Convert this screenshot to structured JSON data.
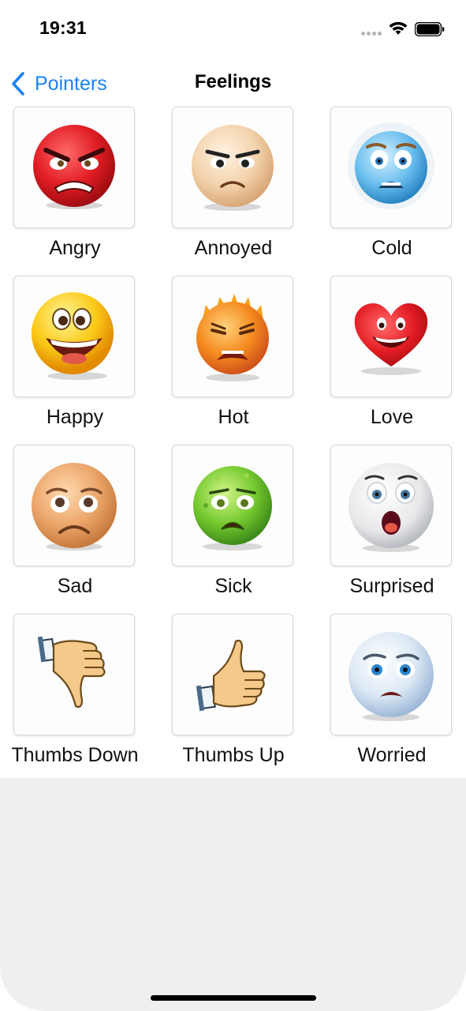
{
  "status_bar": {
    "time": "19:31",
    "icons": [
      "signal-dots-icon",
      "wifi-icon",
      "battery-icon"
    ]
  },
  "nav": {
    "back_label": "Pointers",
    "back_icon": "chevron-left-icon",
    "title": "Feelings",
    "accent_color": "#1a82f7"
  },
  "items": [
    {
      "label": "Angry",
      "icon": "angry-face-icon"
    },
    {
      "label": "Annoyed",
      "icon": "annoyed-face-icon"
    },
    {
      "label": "Cold",
      "icon": "cold-face-icon"
    },
    {
      "label": "Happy",
      "icon": "happy-face-icon"
    },
    {
      "label": "Hot",
      "icon": "hot-face-icon"
    },
    {
      "label": "Love",
      "icon": "heart-face-icon"
    },
    {
      "label": "Sad",
      "icon": "sad-face-icon"
    },
    {
      "label": "Sick",
      "icon": "sick-face-icon"
    },
    {
      "label": "Surprised",
      "icon": "surprised-face-icon"
    },
    {
      "label": "Thumbs Down",
      "icon": "thumbs-down-icon"
    },
    {
      "label": "Thumbs Up",
      "icon": "thumbs-up-icon"
    },
    {
      "label": "Worried",
      "icon": "worried-face-icon"
    }
  ]
}
